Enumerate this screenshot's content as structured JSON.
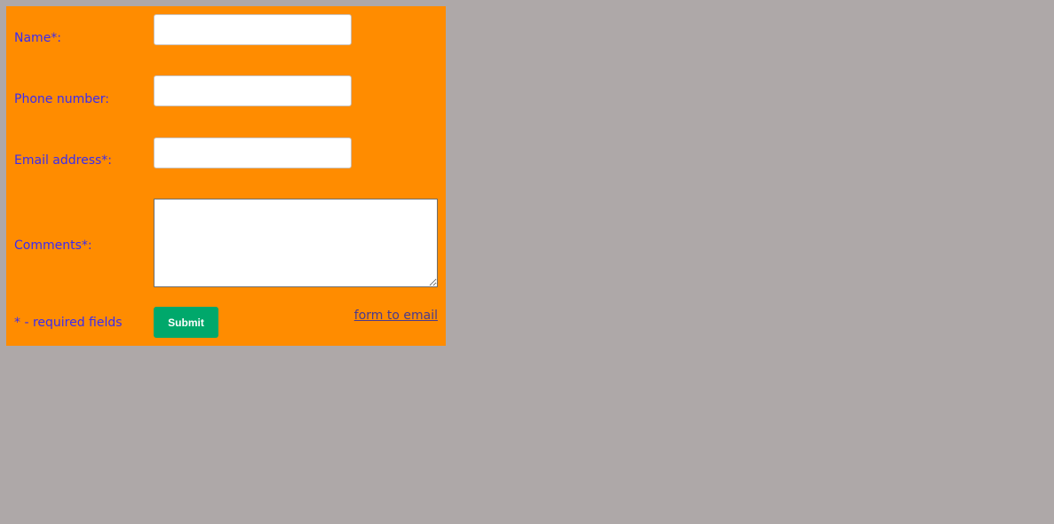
{
  "form": {
    "name_label": "Name*:",
    "name_value": "",
    "phone_label": "Phone number:",
    "phone_value": "",
    "email_label": "Email address*:",
    "email_value": "",
    "comments_label": "Comments*:",
    "comments_value": "",
    "required_note": "* - required fields",
    "submit_label": "Submit",
    "link_text": "form to email"
  },
  "colors": {
    "page_background": "#aea8a8",
    "form_background": "#ff8c00",
    "label_text": "#3a2bf2",
    "submit_button": "#00a86b",
    "link_text": "#4a3a8e"
  }
}
